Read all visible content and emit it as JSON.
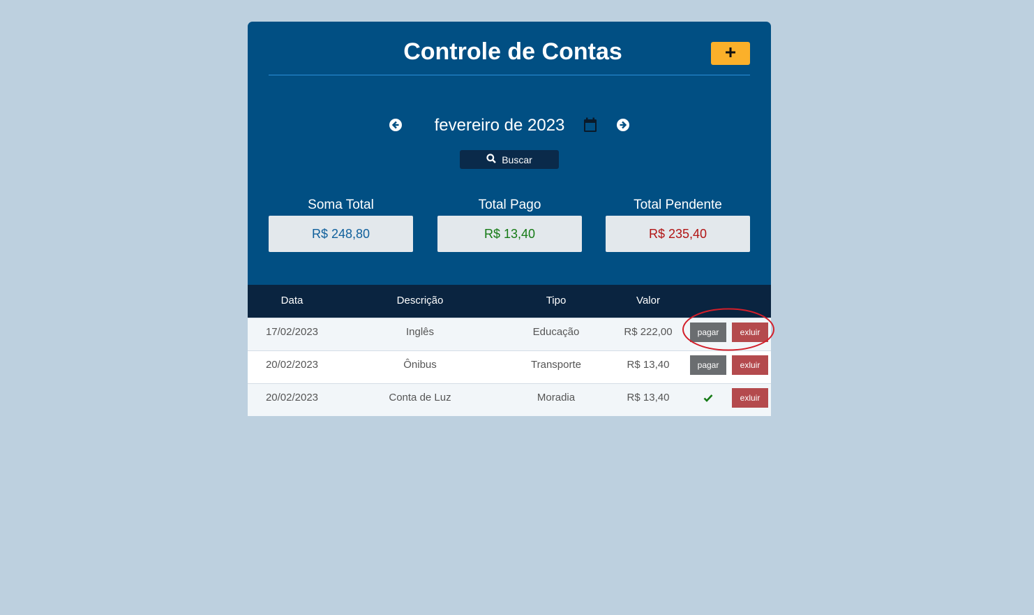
{
  "header": {
    "title": "Controle de Contas",
    "add_button_label": "+"
  },
  "month_nav": {
    "label": "fevereiro de 2023",
    "prev_icon": "arrow-left-circle-icon",
    "next_icon": "arrow-right-circle-icon",
    "calendar_icon": "calendar-icon"
  },
  "search": {
    "label": "Buscar",
    "icon": "search-icon"
  },
  "summary": {
    "total": {
      "label": "Soma Total",
      "value": "R$ 248,80"
    },
    "pago": {
      "label": "Total Pago",
      "value": "R$ 13,40"
    },
    "pendente": {
      "label": "Total Pendente",
      "value": "R$ 235,40"
    }
  },
  "table": {
    "columns": [
      "Data",
      "Descrição",
      "Tipo",
      "Valor"
    ],
    "rows": [
      {
        "data": "17/02/2023",
        "descricao": "Inglês",
        "tipo": "Educação",
        "valor": "R$ 222,00",
        "pago": false,
        "pay_label": "pagar",
        "delete_label": "exluir"
      },
      {
        "data": "20/02/2023",
        "descricao": "Ônibus",
        "tipo": "Transporte",
        "valor": "R$ 13,40",
        "pago": false,
        "pay_label": "pagar",
        "delete_label": "exluir"
      },
      {
        "data": "20/02/2023",
        "descricao": "Conta de Luz",
        "tipo": "Moradia",
        "valor": "R$ 13,40",
        "pago": true,
        "delete_label": "exluir"
      }
    ]
  },
  "colors": {
    "page_bg": "#bdd0df",
    "panel_bg": "#014f83",
    "table_header_bg": "#0a2440",
    "add_button": "#fbb02a",
    "pay_button": "#6a6d70",
    "delete_button": "#b44a4d",
    "value_total": "#10609c",
    "value_paid": "#157a15",
    "value_pending": "#b11414",
    "highlight": "#d31f2a"
  }
}
